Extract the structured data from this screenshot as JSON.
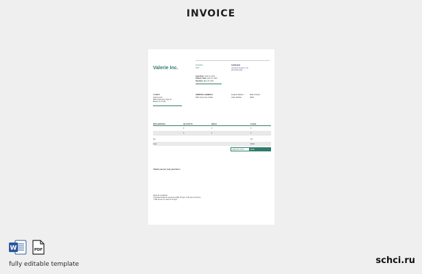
{
  "heading": "INVOICE",
  "invoice": {
    "company": "Valerie Inc.",
    "invoice_label": "INVOICE",
    "invoice_number": "1017",
    "supplier_heading": "SUPPLIER",
    "supplier_email": "valerie@valerieinc.com",
    "supplier_phone": "(212) 555-1234",
    "dates": [
      {
        "label": "Issue Date:",
        "value": "April 22, 2022"
      },
      {
        "label": "Delivery Date:",
        "value": "April 22, 2022"
      },
      {
        "label": "Due Date:",
        "value": "May 20, 2022"
      }
    ],
    "client_heading": "CLIENT",
    "client_lines": [
      "John Doe Inc.",
      "8000 Ocean Ave, Suite 10",
      "Miami, FL 33139"
    ],
    "shipping_heading": "SHIPPING ADDRESS",
    "shipping_lines": [
      "8000 Ocean Ave, Miami"
    ],
    "payment": [
      {
        "label": "Payment Method",
        "value": "Bank Transfer"
      },
      {
        "label": "Order Number",
        "value": "00001"
      }
    ],
    "table": {
      "headers": [
        "DESCRIPTION",
        "QUANTITY",
        "PRICE",
        "TOTAL"
      ],
      "rows": [
        [
          "",
          "0",
          "0",
          "0"
        ],
        [
          "",
          "0",
          "0",
          "0"
        ]
      ]
    },
    "tax_label": "Tax",
    "tax_value": "0%",
    "total_label": "Total",
    "total_value": "$0.00",
    "amount_due_label": "AMOUNT DUE",
    "amount_due_value": "$0.00",
    "thanks": "Thank you for your purchase!",
    "terms_heading": "Terms & Conditions",
    "terms_lines": [
      "• Payment should be received within 30 days of the date of invoice.",
      "• This invoice is valid for 30 days."
    ]
  },
  "caption": "fully editable template",
  "brand": "schci.ru",
  "icons": [
    "word-icon",
    "pdf-icon"
  ],
  "colors": {
    "accent": "#2e7d6b",
    "background": "#efefef",
    "word_blue": "#2b579a"
  }
}
